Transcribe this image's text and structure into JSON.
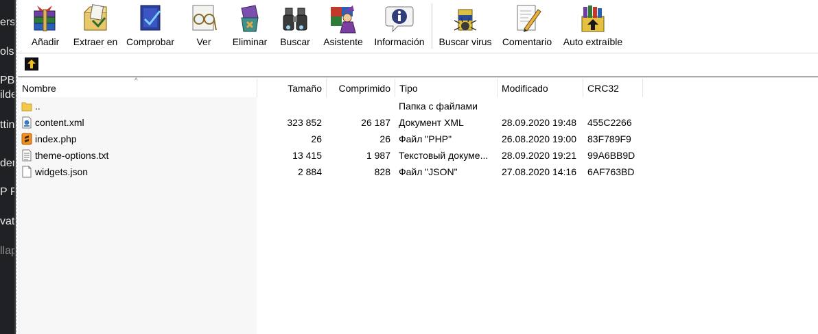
{
  "background_window": {
    "fragments": [
      "ers",
      "ols",
      "PBa",
      "ilde",
      "ttin",
      "der",
      "P Fi",
      "vat",
      "llap"
    ]
  },
  "toolbar": {
    "buttons": [
      {
        "label": "Añadir",
        "icon": "add-archive-icon"
      },
      {
        "label": "Extraer en",
        "icon": "extract-icon"
      },
      {
        "label": "Comprobar",
        "icon": "test-icon"
      },
      {
        "label": "Ver",
        "icon": "view-icon"
      },
      {
        "label": "Eliminar",
        "icon": "delete-icon"
      },
      {
        "label": "Buscar",
        "icon": "find-icon"
      },
      {
        "label": "Asistente",
        "icon": "wizard-icon"
      },
      {
        "label": "Información",
        "icon": "info-icon"
      },
      {
        "label": "Buscar virus",
        "icon": "virus-scan-icon"
      },
      {
        "label": "Comentario",
        "icon": "comment-icon"
      },
      {
        "label": "Auto extraíble",
        "icon": "sfx-icon"
      }
    ]
  },
  "list": {
    "columns": [
      "Nombre",
      "Tamaño",
      "Comprimido",
      "Tipo",
      "Modificado",
      "CRC32"
    ],
    "rows": [
      {
        "name": "..",
        "size": "",
        "packed": "",
        "type": "Папка с файлами",
        "modified": "",
        "crc": "",
        "icon": "folder-icon"
      },
      {
        "name": "content.xml",
        "size": "323 852",
        "packed": "26 187",
        "type": "Документ XML",
        "modified": "28.09.2020 19:48",
        "crc": "455C2266",
        "icon": "xml-file-icon"
      },
      {
        "name": "index.php",
        "size": "26",
        "packed": "26",
        "type": "Файл \"PHP\"",
        "modified": "26.08.2020 19:00",
        "crc": "83F789F9",
        "icon": "php-file-icon"
      },
      {
        "name": "theme-options.txt",
        "size": "13 415",
        "packed": "1 987",
        "type": "Текстовый докуме...",
        "modified": "28.09.2020 19:21",
        "crc": "99A6BB9D",
        "icon": "text-file-icon"
      },
      {
        "name": "widgets.json",
        "size": "2 884",
        "packed": "828",
        "type": "Файл \"JSON\"",
        "modified": "27.08.2020 14:16",
        "crc": "6AF763BD",
        "icon": "json-file-icon"
      }
    ]
  }
}
